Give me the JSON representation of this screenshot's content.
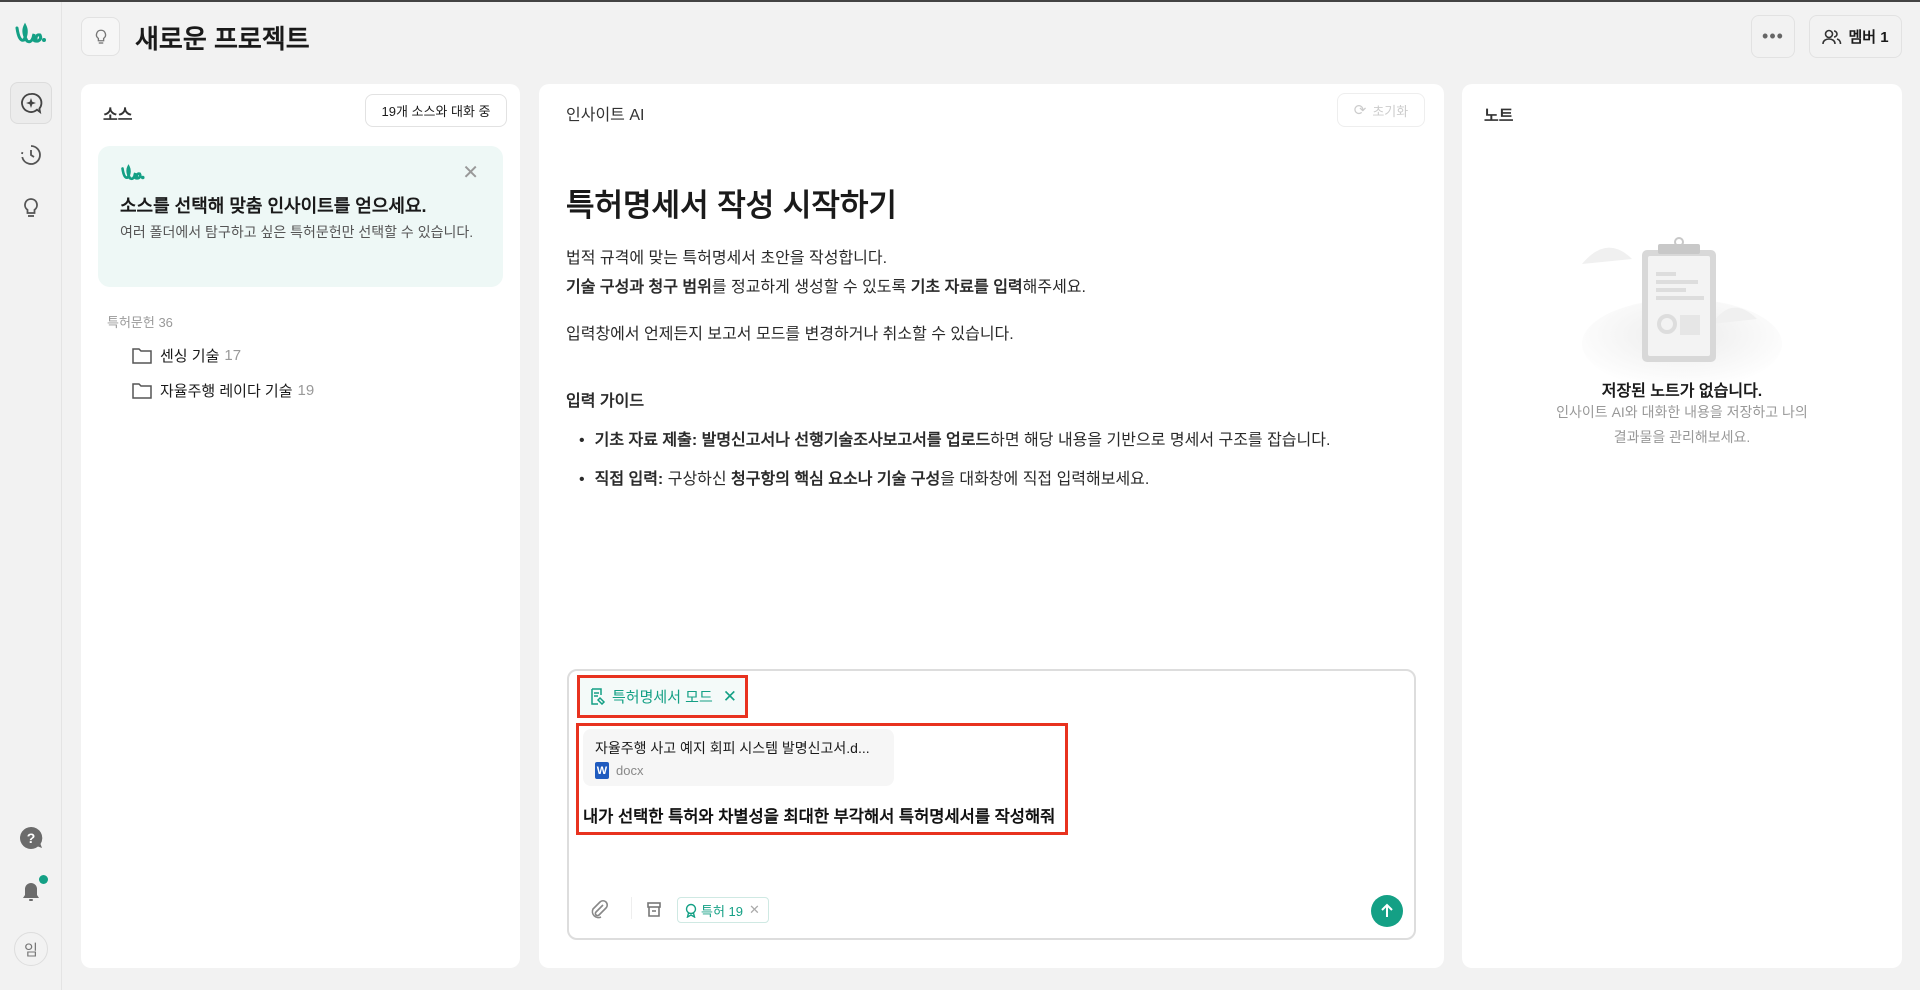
{
  "header": {
    "title": "새로운 프로젝트",
    "members_label": "멤버 1"
  },
  "sources": {
    "title": "소스",
    "chat_status": "19개 소스와 대화 중",
    "banner": {
      "title": "소스를 선택해 맞춤 인사이트를 얻으세요.",
      "description": "여러 폴더에서 탐구하고 싶은 특허문헌만 선택할 수 있습니다."
    },
    "group_label": "특허문헌 36",
    "folders": [
      {
        "name": "센싱 기술",
        "count": "17"
      },
      {
        "name": "자율주행 레이다 기술",
        "count": "19"
      }
    ]
  },
  "insight": {
    "title": "인사이트 AI",
    "reset_label": "초기화",
    "heading": "특허명세서 작성 시작하기",
    "para1": "법적 규격에 맞는 특허명세서 초안을 작성합니다.",
    "para2": [
      {
        "t": "기술 구성과 청구 범위",
        "b": true
      },
      {
        "t": "를 정교하게 생성할 수 있도록 ",
        "b": false
      },
      {
        "t": "기초 자료를 입력",
        "b": true
      },
      {
        "t": "해주세요.",
        "b": false
      }
    ],
    "para3": "입력창에서 언제든지 보고서 모드를 변경하거나 취소할 수 있습니다.",
    "guide_title": "입력 가이드",
    "guide": [
      [
        {
          "t": "기초 자료 제출: ",
          "b": true
        },
        {
          "t": "발명신고서나 선행기술조사보고서를 업로드",
          "b": true
        },
        {
          "t": "하면 해당 내용을 기반으로 명세서 구조를 잡습니다.",
          "b": false
        }
      ],
      [
        {
          "t": "직접 입력: ",
          "b": true
        },
        {
          "t": "구상하신 ",
          "b": false
        },
        {
          "t": "청구항의 핵심 요소나 기술 구성",
          "b": true
        },
        {
          "t": "을 대화창에 직접 입력해보세요.",
          "b": false
        }
      ]
    ],
    "composer": {
      "mode_label": "특허명세서 모드",
      "attachment": {
        "name": "자율주행 사고 예지 회피 시스템 발명신고서.d...",
        "type": "docx"
      },
      "prompt": "내가 선택한 특허와 차별성을 최대한 부각해서 특허명세서를 작성해줘",
      "source_chip": "특허 19"
    }
  },
  "notes": {
    "title": "노트",
    "empty_title": "저장된 노트가 없습니다.",
    "empty_desc_1": "인사이트 AI와 대화한 내용을 저장하고 나의",
    "empty_desc_2": "결과물을 관리해보세요."
  },
  "rail": {
    "avatar": "임"
  },
  "colors": {
    "accent": "#14a085",
    "highlight": "#e8321f"
  }
}
